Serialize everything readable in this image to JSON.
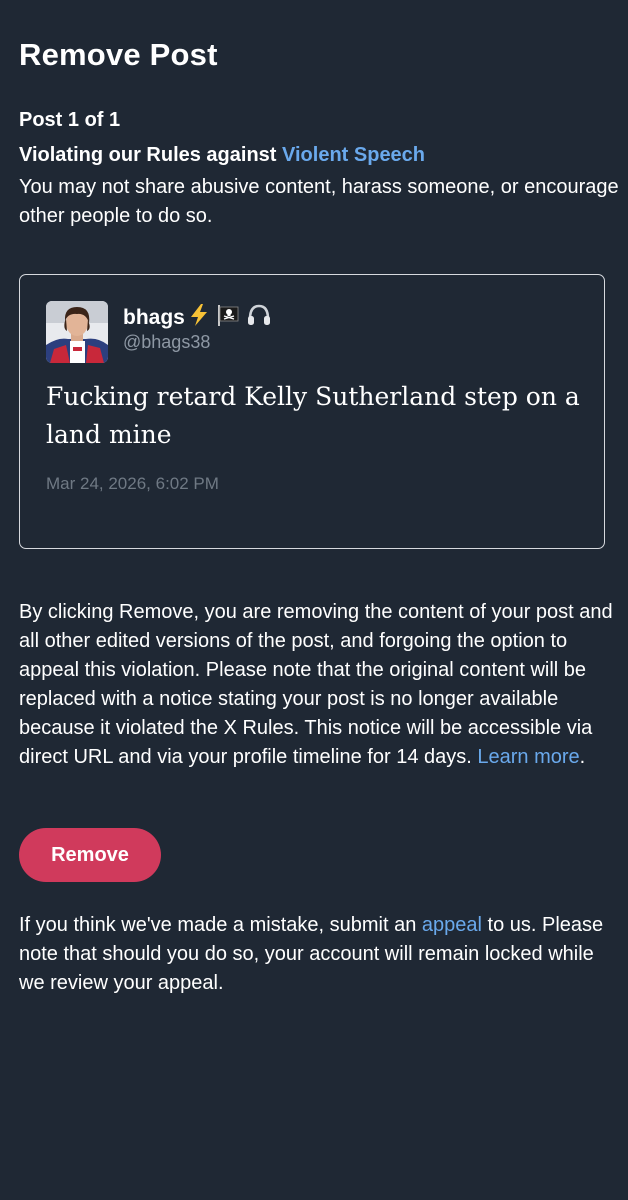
{
  "page": {
    "title": "Remove Post",
    "counter": "Post 1 of 1"
  },
  "rule": {
    "prefix": "Violating our Rules against ",
    "link_label": "Violent Speech",
    "description": "You may not share abusive content, harass someone, or encourage other people to do so."
  },
  "post": {
    "display_name": "bhags",
    "name_emojis": [
      "lightning-emoji",
      "pirate-flag-emoji",
      "headphones-emoji"
    ],
    "handle": "@bhags38",
    "text": "Fucking retard Kelly Sutherland step on a land mine",
    "timestamp": "Mar 24, 2026, 6:02 PM"
  },
  "explanation": {
    "text": "By clicking Remove, you are removing the content of your post and all other edited versions of the post, and forgoing the option to appeal this violation. Please note that the original content will be replaced with a notice stating your post is no longer available because it violated the X Rules. This notice will be accessible via direct URL and via your profile timeline for 14 days. ",
    "link_label": "Learn more",
    "suffix": "."
  },
  "remove_button": {
    "label": "Remove"
  },
  "appeal": {
    "prefix": "If you think we've made a mistake, submit an ",
    "link_label": "appeal",
    "suffix": " to us. Please note that should you do so, your account will remain locked while we review your appeal."
  },
  "colors": {
    "background": "#1f2834",
    "link": "#6aa9ec",
    "remove_button": "#d03a5c",
    "card_border": "#d6d9de",
    "muted_text": "#8e98a4"
  }
}
